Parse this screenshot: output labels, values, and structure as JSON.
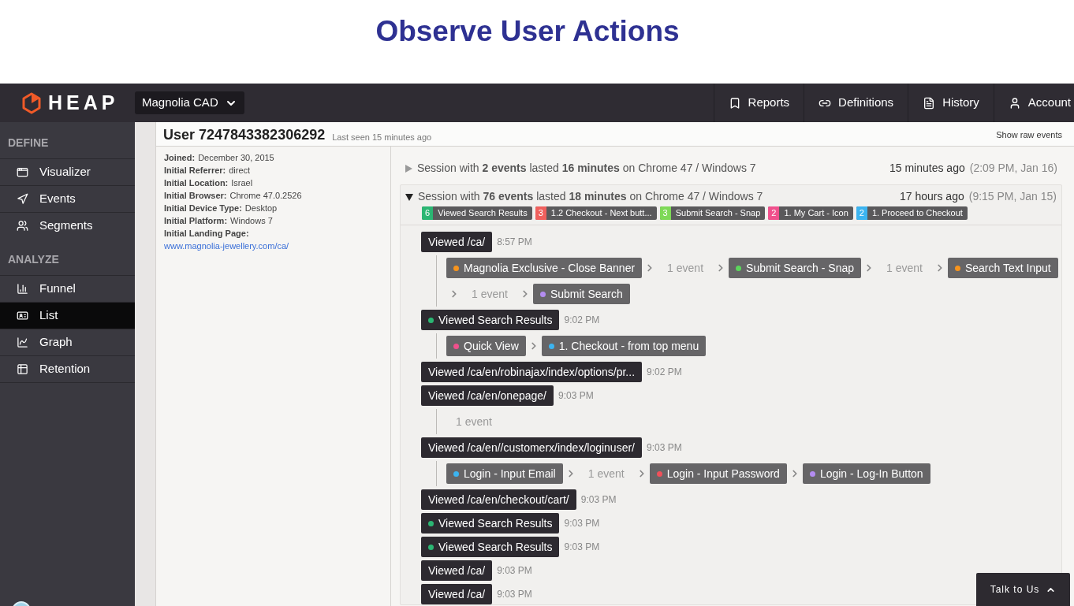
{
  "slide_title": "Observe User Actions",
  "topbar": {
    "logo": "HEAP",
    "project": "Magnolia CAD",
    "nav": [
      {
        "label": "Reports"
      },
      {
        "label": "Definitions"
      },
      {
        "label": "History"
      },
      {
        "label": "Account"
      }
    ]
  },
  "sidebar": [
    {
      "heading": "DEFINE",
      "items": [
        {
          "label": "Visualizer",
          "selected": false
        },
        {
          "label": "Events",
          "selected": false
        },
        {
          "label": "Segments",
          "selected": false
        }
      ]
    },
    {
      "heading": "ANALYZE",
      "items": [
        {
          "label": "Funnel",
          "selected": false
        },
        {
          "label": "List",
          "selected": true
        },
        {
          "label": "Graph",
          "selected": false
        },
        {
          "label": "Retention",
          "selected": false
        }
      ]
    }
  ],
  "user": {
    "title": "User 7247843382306292",
    "last_seen": "Last seen 15 minutes ago",
    "raw_link": "Show raw events",
    "properties": [
      {
        "label": "Joined:",
        "value": "December 30, 2015",
        "kind": "text"
      },
      {
        "label": "Initial Referrer:",
        "value": "direct",
        "kind": "text"
      },
      {
        "label": "Initial Location:",
        "value": "Israel",
        "kind": "text"
      },
      {
        "label": "Initial Browser:",
        "value": "Chrome 47.0.2526",
        "kind": "text"
      },
      {
        "label": "Initial Device Type:",
        "value": "Desktop",
        "kind": "text"
      },
      {
        "label": "Initial Platform:",
        "value": "Windows 7",
        "kind": "text"
      },
      {
        "label": "Initial Landing Page:",
        "value": "www.magnolia-jewellery.com/ca/",
        "kind": "link"
      }
    ]
  },
  "sessions": [
    {
      "expanded": false,
      "summary": "Session with **2 events** lasted **16 minutes** on Chrome 47 / Windows 7",
      "ago": "15 minutes ago",
      "when": "(2:09 PM, Jan 16)"
    },
    {
      "expanded": true,
      "summary": "Session with **76 events** lasted **18 minutes** on Chrome 47 / Windows 7",
      "ago": "17 hours ago",
      "when": "(9:15 PM, Jan 15)",
      "tags": [
        {
          "count": "6",
          "label": "Viewed Search Results",
          "color": "#2bb673"
        },
        {
          "count": "3",
          "label": "1.2 Checkout - Next butt...",
          "color": "#f0605d"
        },
        {
          "count": "3",
          "label": "Submit Search - Snap",
          "color": "#7ed957"
        },
        {
          "count": "2",
          "label": "1. My Cart - Icon",
          "color": "#f0508c"
        },
        {
          "count": "2",
          "label": "1. Proceed to Checkout",
          "color": "#3cb4f0"
        }
      ],
      "timeline": [
        {
          "page": "Viewed /ca/",
          "time": "8:57 PM",
          "events": [
            {
              "kind": "event",
              "label": "Magnolia Exclusive - Close Banner",
              "color": "#f7941d"
            },
            {
              "kind": "gap",
              "label": "1 event"
            },
            {
              "kind": "event",
              "label": "Submit Search - Snap",
              "color": "#5cd65c"
            },
            {
              "kind": "gap",
              "label": "1 event"
            },
            {
              "kind": "event",
              "label": "Search Text Input",
              "color": "#f7941d"
            },
            {
              "kind": "gap",
              "label": "1 event"
            },
            {
              "kind": "event",
              "label": "Submit Search",
              "color": "#b38cf0"
            }
          ]
        },
        {
          "page": "Viewed Search Results",
          "color": "#2bb673",
          "time": "9:02 PM",
          "events": [
            {
              "kind": "event",
              "label": "Quick View",
              "color": "#f0508c"
            },
            {
              "kind": "event",
              "label": "1. Checkout - from top menu",
              "color": "#3cb4f0"
            }
          ]
        },
        {
          "page": "Viewed /ca/en/robinajax/index/options/pr...",
          "time": "9:02 PM"
        },
        {
          "page": "Viewed /ca/en/onepage/",
          "time": "9:03 PM",
          "events": [
            {
              "kind": "gap",
              "label": "1 event"
            }
          ]
        },
        {
          "page": "Viewed /ca/en//customerx/index/loginuser/",
          "time": "9:03 PM",
          "events": [
            {
              "kind": "event",
              "label": "Login - Input Email",
              "color": "#3cb4f0"
            },
            {
              "kind": "gap",
              "label": "1 event"
            },
            {
              "kind": "event",
              "label": "Login - Input Password",
              "color": "#f0505a"
            },
            {
              "kind": "event",
              "label": "Login - Log-In Button",
              "color": "#b38cf0"
            }
          ]
        },
        {
          "page": "Viewed /ca/en/checkout/cart/",
          "time": "9:03 PM"
        },
        {
          "page": "Viewed Search Results",
          "color": "#2bb673",
          "time": "9:03 PM"
        },
        {
          "page": "Viewed Search Results",
          "color": "#2bb673",
          "time": "9:03 PM"
        },
        {
          "page": "Viewed /ca/",
          "time": "9:03 PM"
        },
        {
          "page": "Viewed /ca/",
          "time": "9:03 PM"
        }
      ]
    }
  ],
  "chat_button": "Talk to Us"
}
